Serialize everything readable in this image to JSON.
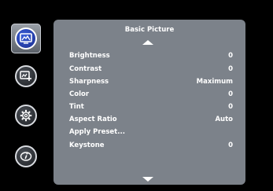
{
  "menu": {
    "title": "Basic Picture",
    "items": [
      {
        "label": "Brightness",
        "value": "0"
      },
      {
        "label": "Contrast",
        "value": "0"
      },
      {
        "label": "Sharpness",
        "value": "Maximum"
      },
      {
        "label": "Color",
        "value": "0"
      },
      {
        "label": "Tint",
        "value": "0"
      },
      {
        "label": "Aspect Ratio",
        "value": "Auto"
      },
      {
        "label": "Apply Preset...",
        "value": ""
      },
      {
        "label": "Keystone",
        "value": "0"
      }
    ]
  },
  "sidebar": {
    "icons": [
      {
        "name": "basic-picture-icon",
        "active": true
      },
      {
        "name": "advanced-picture-icon",
        "active": false
      },
      {
        "name": "settings-gear-icon",
        "active": false
      },
      {
        "name": "information-icon",
        "active": false
      }
    ]
  },
  "colors": {
    "panel_bg": "#7c828a",
    "active_icon": "#2a44b8",
    "text": "#ffffff"
  }
}
